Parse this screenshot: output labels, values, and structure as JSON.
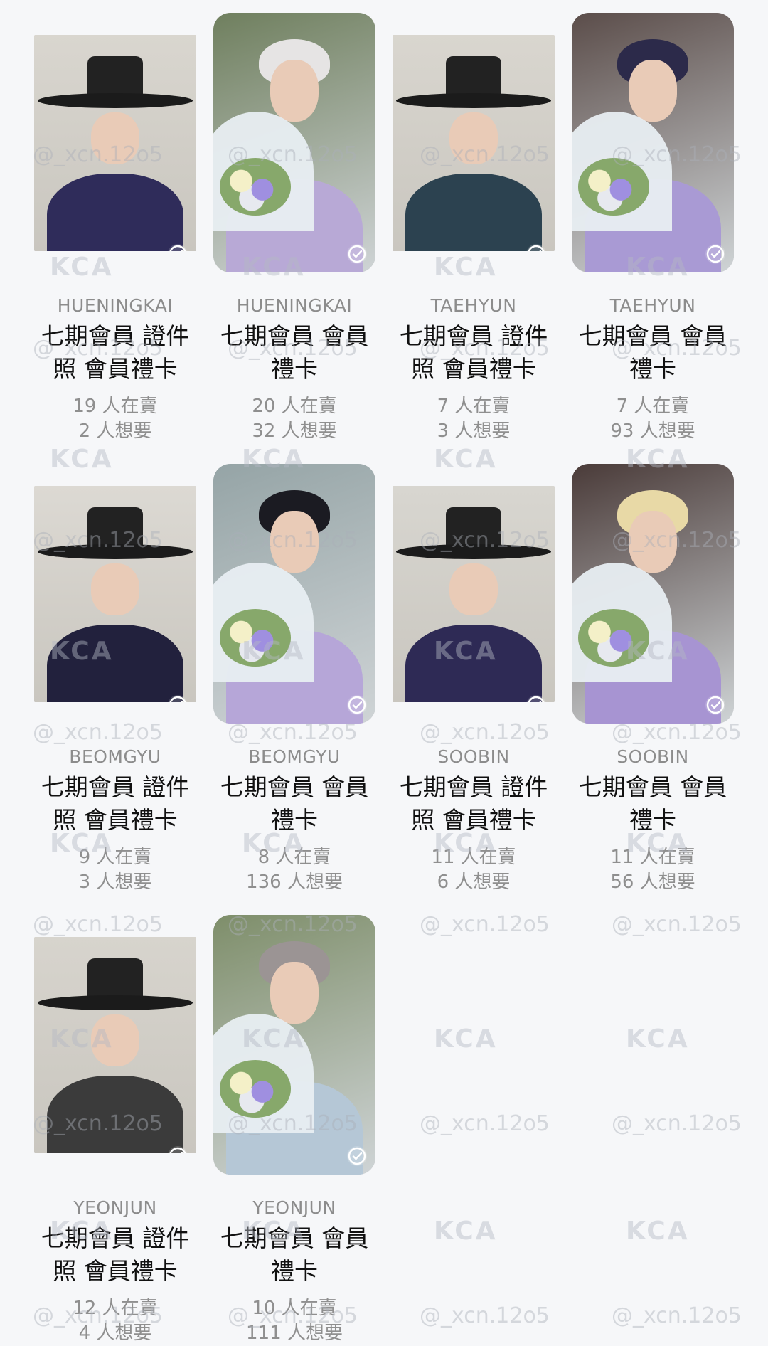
{
  "cards": [
    {
      "member": "HUENINGKAI",
      "title": "七期會員 證件照 會員禮卡",
      "selling": "19 人在賣",
      "wanting": "2 人想要",
      "photo_style": "id",
      "colors": {
        "bg": "#d9d6cf",
        "robe": "#2f2c5a",
        "hair": "#1a1a1a"
      }
    },
    {
      "member": "HUENINGKAI",
      "title": "七期會員 會員禮卡",
      "selling": "20 人在賣",
      "wanting": "32 人想要",
      "photo_style": "fan",
      "colors": {
        "bg": "#6f7f5e",
        "robe": "#b8a9d6",
        "hair": "#e6e4e4"
      }
    },
    {
      "member": "TAEHYUN",
      "title": "七期會員 證件照 會員禮卡",
      "selling": "7 人在賣",
      "wanting": "3 人想要",
      "photo_style": "id",
      "colors": {
        "bg": "#d9d6cf",
        "robe": "#2c4250",
        "hair": "#1a1a1a"
      }
    },
    {
      "member": "TAEHYUN",
      "title": "七期會員 會員禮卡",
      "selling": "7 人在賣",
      "wanting": "93 人想要",
      "photo_style": "fan",
      "colors": {
        "bg": "#5b4d4a",
        "robe": "#a99ad4",
        "hair": "#2c2a4a"
      }
    },
    {
      "member": "BEOMGYU",
      "title": "七期會員 證件照 會員禮卡",
      "selling": "9 人在賣",
      "wanting": "3 人想要",
      "photo_style": "id",
      "colors": {
        "bg": "#dcd9d3",
        "robe": "#22213d",
        "hair": "#1a1a1a"
      }
    },
    {
      "member": "BEOMGYU",
      "title": "七期會員 會員禮卡",
      "selling": "8 人在賣",
      "wanting": "136 人想要",
      "photo_style": "fan",
      "colors": {
        "bg": "#95a4a6",
        "robe": "#b6a6d8",
        "hair": "#1b1b22"
      }
    },
    {
      "member": "SOOBIN",
      "title": "七期會員 證件照 會員禮卡",
      "selling": "11 人在賣",
      "wanting": "6 人想要",
      "photo_style": "id",
      "colors": {
        "bg": "#d8d6d0",
        "robe": "#2e2a55",
        "hair": "#1a1a1a"
      }
    },
    {
      "member": "SOOBIN",
      "title": "七期會員 會員禮卡",
      "selling": "11 人在賣",
      "wanting": "56 人想要",
      "photo_style": "fan",
      "colors": {
        "bg": "#4a3b39",
        "robe": "#a794d2",
        "hair": "#e8d9a6"
      }
    },
    {
      "member": "YEONJUN",
      "title": "七期會員 證件照 會員禮卡",
      "selling": "12 人在賣",
      "wanting": "4 人想要",
      "photo_style": "id",
      "colors": {
        "bg": "#d7d4cd",
        "robe": "#3b3b3b",
        "hair": "#1a1a1a"
      }
    },
    {
      "member": "YEONJUN",
      "title": "七期會員 會員禮卡",
      "selling": "10 人在賣",
      "wanting": "111 人想要",
      "photo_style": "fan",
      "colors": {
        "bg": "#7e8e6a",
        "robe": "#b5c7d6",
        "hair": "#9b9494"
      }
    }
  ],
  "watermarks": {
    "handle": "@_xcn.12o5",
    "logo": "KCA"
  },
  "icons": {
    "check": "check-circle-icon"
  }
}
